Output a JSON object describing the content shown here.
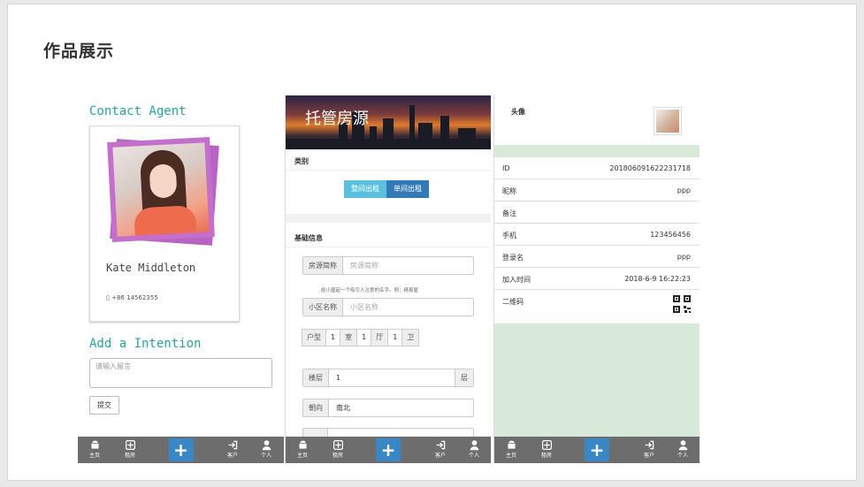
{
  "slide": {
    "title": "作品展示"
  },
  "tabbar": {
    "home": "主页",
    "rent": "租房",
    "client": "客户",
    "me": "个人",
    "add_symbol": "+"
  },
  "screen1": {
    "contact_title": "Contact Agent",
    "agent_name": "Kate Middleton",
    "agent_phone": "+86 14562355",
    "intention_title": "Add a Intention",
    "message_placeholder": "请输入留言",
    "submit_label": "提交"
  },
  "screen2": {
    "banner_title": "托管房源",
    "category_heading": "类别",
    "segment": [
      "整间出租",
      "单间出租"
    ],
    "basic_heading": "基础信息",
    "house_name_label": "房源简称",
    "house_name_placeholder": "房源简称",
    "hint": "给小屋起一个吸引人注意的名字。例：精易屋",
    "community_label": "小区名称",
    "community_placeholder": "小区名称",
    "layout": [
      {
        "label": "户型",
        "type": "label"
      },
      {
        "label": "1",
        "type": "value"
      },
      {
        "label": "室",
        "type": "label"
      },
      {
        "label": "1",
        "type": "value"
      },
      {
        "label": "厅",
        "type": "label"
      },
      {
        "label": "1",
        "type": "value"
      },
      {
        "label": "卫",
        "type": "label"
      }
    ],
    "floor_label": "楼层",
    "floor_value": "1",
    "floor_suffix": "层",
    "orientation_label": "朝向",
    "orientation_value": "南北"
  },
  "screen3": {
    "avatar_label": "头像",
    "rows": [
      {
        "key": "ID",
        "value": "20180609162223171 8"
      },
      {
        "key": "昵称",
        "value": "ppp"
      },
      {
        "key": "备注",
        "value": ""
      },
      {
        "key": "手机",
        "value": "123456456"
      },
      {
        "key": "登录名",
        "value": "ppp"
      },
      {
        "key": "加入时间",
        "value": "2018-6-9 16:22:23"
      }
    ],
    "qr_label": "二维码"
  },
  "colors": {
    "accent_teal": "#26a69a",
    "frame_purple": "#c46fcc",
    "tabbar_gray": "#6d6d6d",
    "plus_blue": "#3a87c8",
    "segment_light": "#5bc0de",
    "segment_dark": "#337ab7",
    "profile_green": "#d7e9d9"
  }
}
